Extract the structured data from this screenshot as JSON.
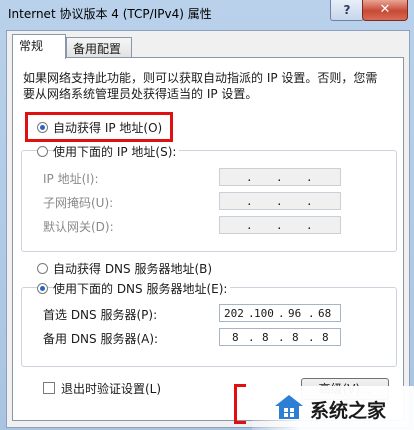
{
  "window": {
    "title": "Internet 协议版本 4 (TCP/IPv4) 属性",
    "help_glyph": "?",
    "close_glyph": "✕"
  },
  "tabs": [
    {
      "label": "常规"
    },
    {
      "label": "备用配置"
    }
  ],
  "description": "如果网络支持此功能，则可以获取自动指派的 IP 设置。否则，您需要从网络系统管理员处获得适当的 IP 设置。",
  "ip_mode": {
    "auto_label": "自动获得 IP 地址(O)",
    "manual_label": "使用下面的 IP 地址(S):",
    "selected": "auto"
  },
  "ip_fields": [
    {
      "label": "IP 地址(I):",
      "octets": [
        "",
        "",
        "",
        ""
      ]
    },
    {
      "label": "子网掩码(U):",
      "octets": [
        "",
        "",
        "",
        ""
      ]
    },
    {
      "label": "默认网关(D):",
      "octets": [
        "",
        "",
        "",
        ""
      ]
    }
  ],
  "dns_mode": {
    "auto_label": "自动获得 DNS 服务器地址(B)",
    "manual_label": "使用下面的 DNS 服务器地址(E):",
    "selected": "manual"
  },
  "dns_fields": [
    {
      "label": "首选 DNS 服务器(P):",
      "octets": [
        "202",
        "100",
        "96",
        "68"
      ]
    },
    {
      "label": "备用 DNS 服务器(A):",
      "octets": [
        "8",
        "8",
        "8",
        "8"
      ]
    }
  ],
  "validate_on_exit": {
    "label": "退出时验证设置(L)",
    "checked": false
  },
  "advanced_button": {
    "label": "高级(V)..."
  },
  "watermark": {
    "text": "系统之家"
  },
  "colors": {
    "highlight": "#e01010",
    "radio_dot": "#2a63c6",
    "close_button": "#c74a36"
  }
}
